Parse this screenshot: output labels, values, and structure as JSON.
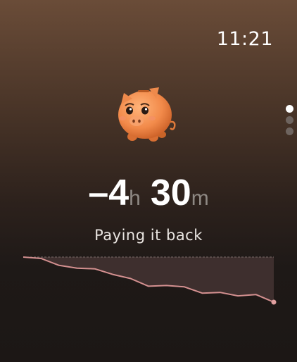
{
  "status_bar": {
    "time": "11:21"
  },
  "mascot": {
    "icon": "sad-piggy-bank-icon"
  },
  "page_indicator": {
    "count": 3,
    "active_index": 0
  },
  "balance": {
    "sign": "–",
    "hours": "4",
    "hours_unit": "h",
    "minutes": "30",
    "minutes_unit": "m"
  },
  "subtitle": "Paying it back",
  "colors": {
    "line": "#d49090",
    "fill": "#3e2f2e",
    "baseline": "#7a6d6b",
    "end_dot": "#e1a0a0"
  },
  "chart_data": {
    "type": "area",
    "values": [
      0,
      -0.1,
      -0.6,
      -0.8,
      -0.85,
      -1.25,
      -1.55,
      -2.1,
      -2.05,
      -2.15,
      -2.6,
      -2.55,
      -2.8,
      -2.7,
      -3.25
    ]
  }
}
